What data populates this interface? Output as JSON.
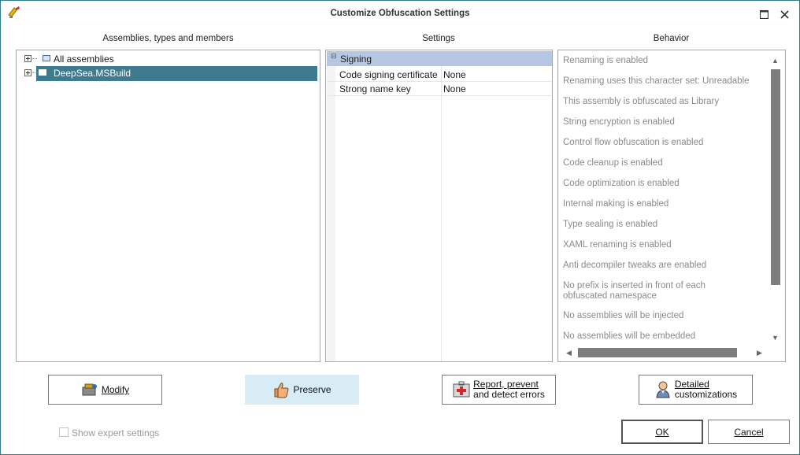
{
  "window": {
    "title": "Customize Obfuscation Settings"
  },
  "panels": {
    "assemblies_label": "Assemblies, types and members",
    "settings_label": "Settings",
    "behavior_label": "Behavior"
  },
  "tree": {
    "items": [
      {
        "label": "All assemblies",
        "selected": false
      },
      {
        "label": "DeepSea.MSBuild",
        "selected": true
      }
    ]
  },
  "settings": {
    "category": "Signing",
    "rows": [
      {
        "name": "Code signing certificate",
        "value": "None"
      },
      {
        "name": "Strong name key",
        "value": "None"
      }
    ]
  },
  "behavior": {
    "items": [
      "Renaming is enabled",
      "Renaming uses this character set: Unreadable",
      "This assembly is obfuscated as Library",
      "String encryption is enabled",
      "Control flow obfuscation is enabled",
      "Code cleanup is enabled",
      "Code optimization is enabled",
      "Internal making is enabled",
      "Type sealing is enabled",
      "XAML renaming is enabled",
      "Anti decompiler tweaks are enabled",
      "No prefix is inserted in front of each obfuscated namespace",
      "No assemblies will be injected",
      "No assemblies will be embedded"
    ]
  },
  "actions": {
    "modify": "Modify",
    "preserve": "Preserve",
    "report_line1": "Report, prevent",
    "report_line2": "and detect errors",
    "detailed_line1": "Detailed",
    "detailed_line2": "customizations"
  },
  "footer": {
    "show_expert": "Show expert settings",
    "ok": "OK",
    "cancel": "Cancel"
  },
  "colors": {
    "accent": "#3e7b8f",
    "border": "#2f7f8d",
    "category_header": "#b5c7e2",
    "highlight_button": "#d7ecf5"
  },
  "icons": [
    "app-icon",
    "maximize-icon",
    "close-icon",
    "modify-icon",
    "thumbs-up-icon",
    "first-aid-icon",
    "person-icon"
  ]
}
